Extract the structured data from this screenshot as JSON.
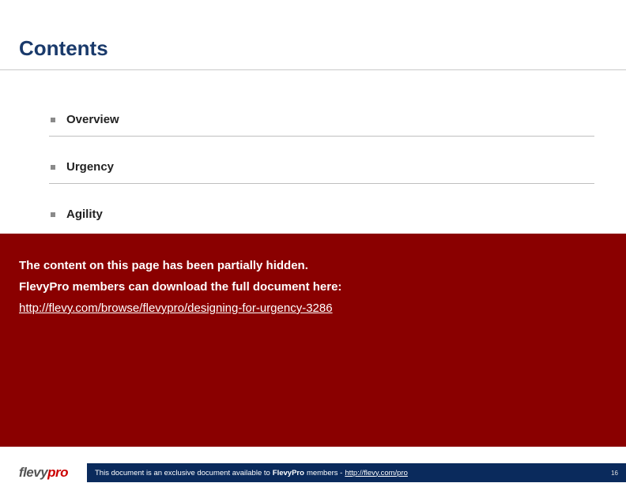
{
  "title": "Contents",
  "toc": [
    {
      "label": "Overview"
    },
    {
      "label": "Urgency"
    },
    {
      "label": "Agility"
    }
  ],
  "overlay": {
    "line1": "The content on this page has been partially hidden.",
    "line2": "FlevyPro members can download the full document here:",
    "link_text": "http://flevy.com/browse/flevypro/designing-for-urgency-3286"
  },
  "footer": {
    "logo_part1": "flevy",
    "logo_part2": "pro",
    "text_prefix": "This document is an exclusive document available to ",
    "text_bold": "FlevyPro",
    "text_mid": " members - ",
    "link_text": "http://flevy.com/pro",
    "page_number": "16"
  }
}
